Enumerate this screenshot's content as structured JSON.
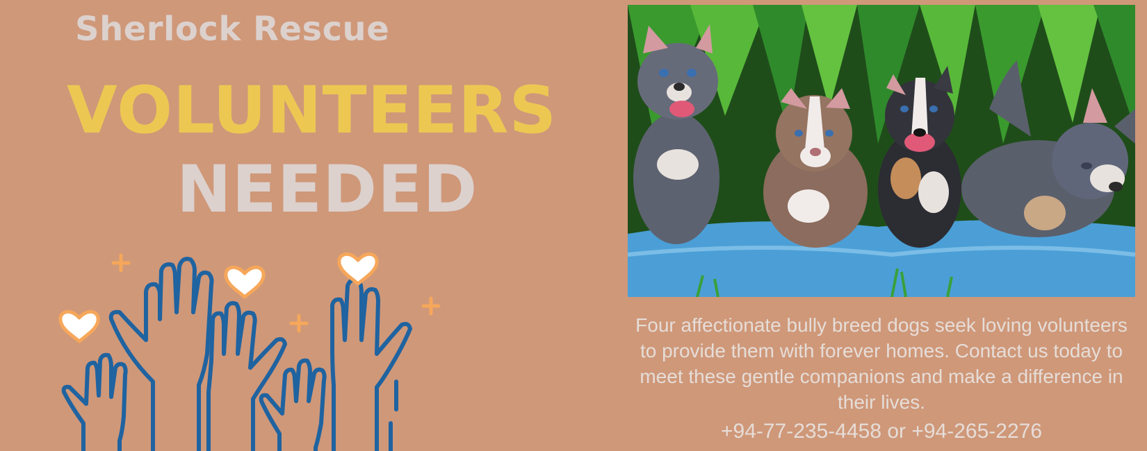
{
  "poster": {
    "org_name": "Sherlock Rescue",
    "headline_line1": "VOLUNTEERS",
    "headline_line2": "NEEDED",
    "description": "Four affectionate bully breed dogs seek loving volunteers to provide them with forever homes. Contact us today to meet these gentle companions and make a difference in their lives.",
    "phones": "+94-77-235-4458 or +94-265-2276"
  },
  "illustration": {
    "icon": "raised-hands-with-hearts-icon",
    "hand_color": "#1f63a0",
    "heart_color": "#f6a75a"
  },
  "photo": {
    "subject": "four-puppies-on-blue-blanket",
    "blanket_color": "#4b9fd6",
    "foliage_color": "#2f8a2b"
  },
  "colors": {
    "background": "#cf9879",
    "headline_yellow": "#ecc853",
    "light_text": "#dcd1cd"
  }
}
